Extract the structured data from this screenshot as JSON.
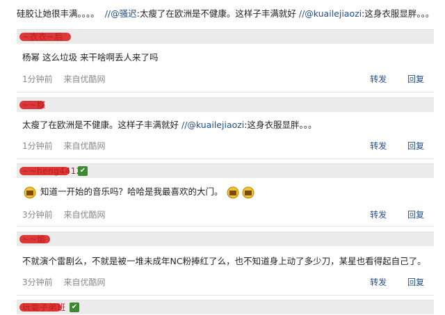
{
  "top_line": {
    "text_a": "硅胶让她很丰满。。。。",
    "mention_1": "//@骚迟",
    "text_b": ":太瘦了在欧洲是不健康。这样子丰满就好",
    "mention_2": "//@kuailejiaozi",
    "text_c": ":这身衣服显胖。。。"
  },
  "comments": [
    {
      "username": "~衣衣~后",
      "content": "杨幂 这么垃圾 来干啥啊丢人来了吗",
      "time": "1分钟前",
      "source": "来自优酷网",
      "repost": "转发",
      "reply": "回复"
    },
    {
      "username": "~~蝶",
      "content_a": "太瘦了在欧洲是不健康。这样子丰满就好",
      "mention": "//@kuailejiaozi",
      "content_b": ":这身衣服显胖。。。",
      "time": "1分钟前",
      "source": "来自优酷网",
      "repost": "转发",
      "reply": "回复"
    },
    {
      "username": "~~heng4412",
      "content": "知道一开始的音乐吗？哈哈是我最喜欢的大门。",
      "time": "3分钟前",
      "source": "来自优酷网",
      "repost": "转发",
      "reply": "回复"
    },
    {
      "username": "~~焰",
      "content": "不就演个雷剧么，不就是被一堆未成年NC粉捧红了么，也不知道身上动了多少刀，某星也看得起自己了。",
      "time": "3分钟前",
      "source": "来自优酷网",
      "repost": "转发",
      "reply": "回复"
    },
    {
      "username": "玩耍子弟班"
    }
  ],
  "colors": {
    "link": "#1f4e8c",
    "username": "#c2191e",
    "header_bg": "#ebebeb",
    "meta": "#888888",
    "vip_badge": "#3c8a2e"
  }
}
